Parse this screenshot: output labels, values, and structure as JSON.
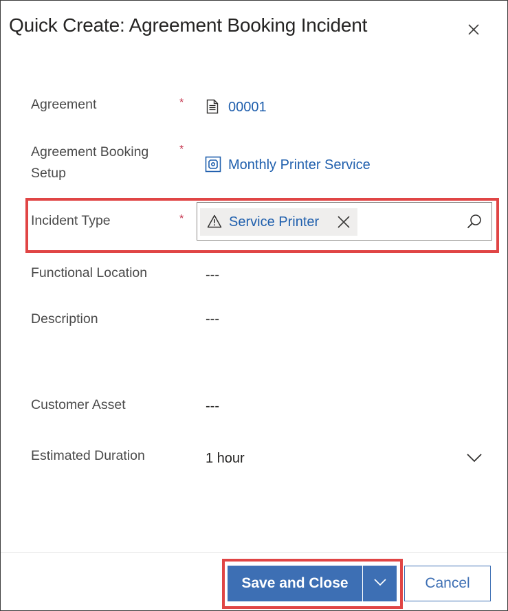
{
  "dialog": {
    "title": "Quick Create: Agreement Booking Incident",
    "close_icon": "close-icon"
  },
  "fields": {
    "agreement": {
      "label": "Agreement",
      "required": "*",
      "value": "00001",
      "icon": "document-icon"
    },
    "booking_setup": {
      "label_line1": "Agreement Booking",
      "label_line2": "Setup",
      "required": "*",
      "value": "Monthly Printer Service",
      "icon": "entity-icon"
    },
    "incident_type": {
      "label": "Incident Type",
      "required": "*",
      "value": "Service Printer",
      "icon": "warning-icon",
      "remove_icon": "close-icon",
      "search_icon": "search-icon"
    },
    "functional_location": {
      "label": "Functional Location",
      "value": "---"
    },
    "description": {
      "label": "Description",
      "value": "---"
    },
    "customer_asset": {
      "label": "Customer Asset",
      "value": "---"
    },
    "estimated_duration": {
      "label": "Estimated Duration",
      "value": "1 hour",
      "icon": "chevron-down-icon"
    }
  },
  "footer": {
    "save_label": "Save and Close",
    "cancel_label": "Cancel"
  },
  "colors": {
    "accent": "#3d6fb4",
    "link": "#1f5fad",
    "required": "#c4314b",
    "highlight": "#e04545"
  }
}
